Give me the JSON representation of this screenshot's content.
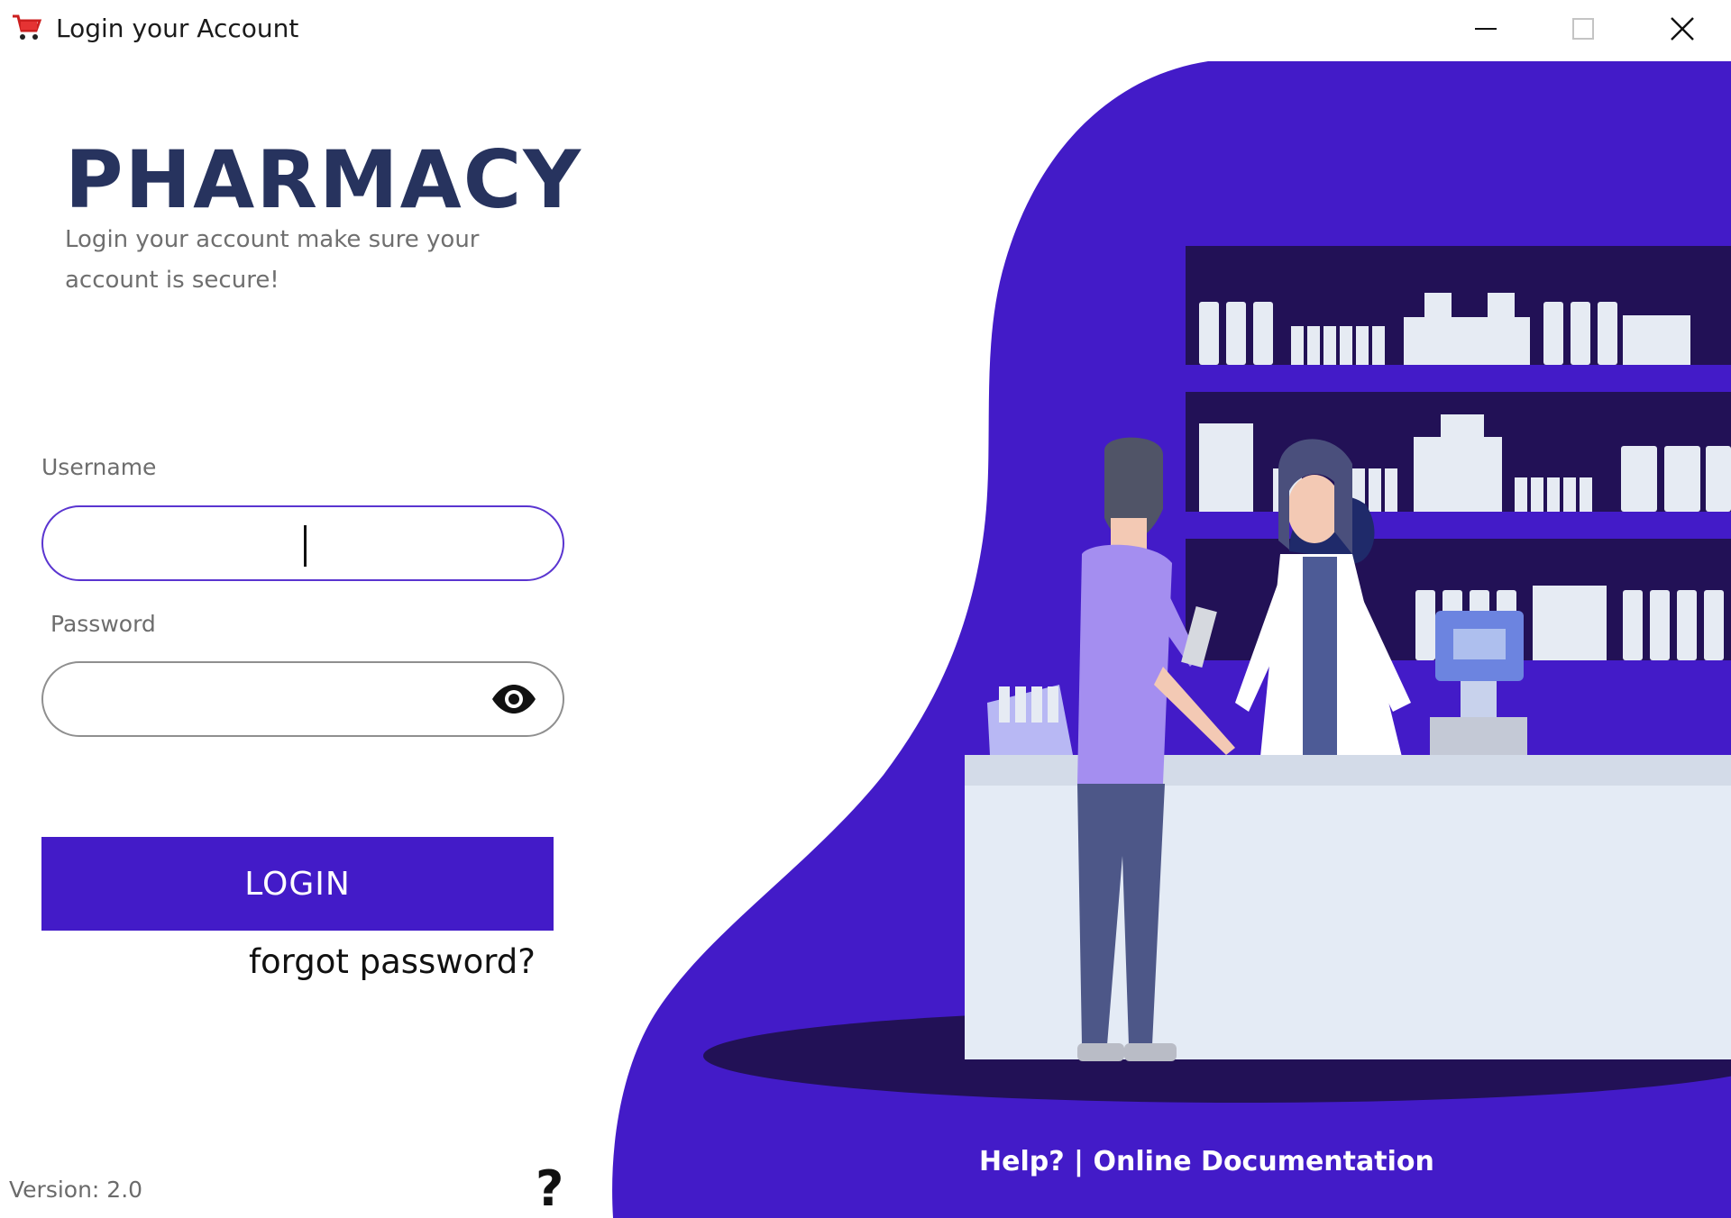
{
  "window": {
    "title": "Login your Account",
    "app_icon": "shopping-cart-icon",
    "controls": [
      "minimize-icon",
      "maximize-icon",
      "close-icon"
    ]
  },
  "brand": {
    "title": "PHARMACY",
    "subtitle": "Login your account make sure your account is secure!"
  },
  "form": {
    "username_label": "Username",
    "username_value": "",
    "password_label": "Password",
    "password_value": "",
    "password_toggle_icon": "eye-icon",
    "login_label": "LOGIN",
    "forgot_label": "forgot password?"
  },
  "footer": {
    "version": "Version: 2.0",
    "help_icon_glyph": "?",
    "help_link": "Help? | Online Documentation"
  },
  "colors": {
    "accent": "#431bc8",
    "brand_title": "#27335e",
    "panel_dark": "#221156"
  }
}
